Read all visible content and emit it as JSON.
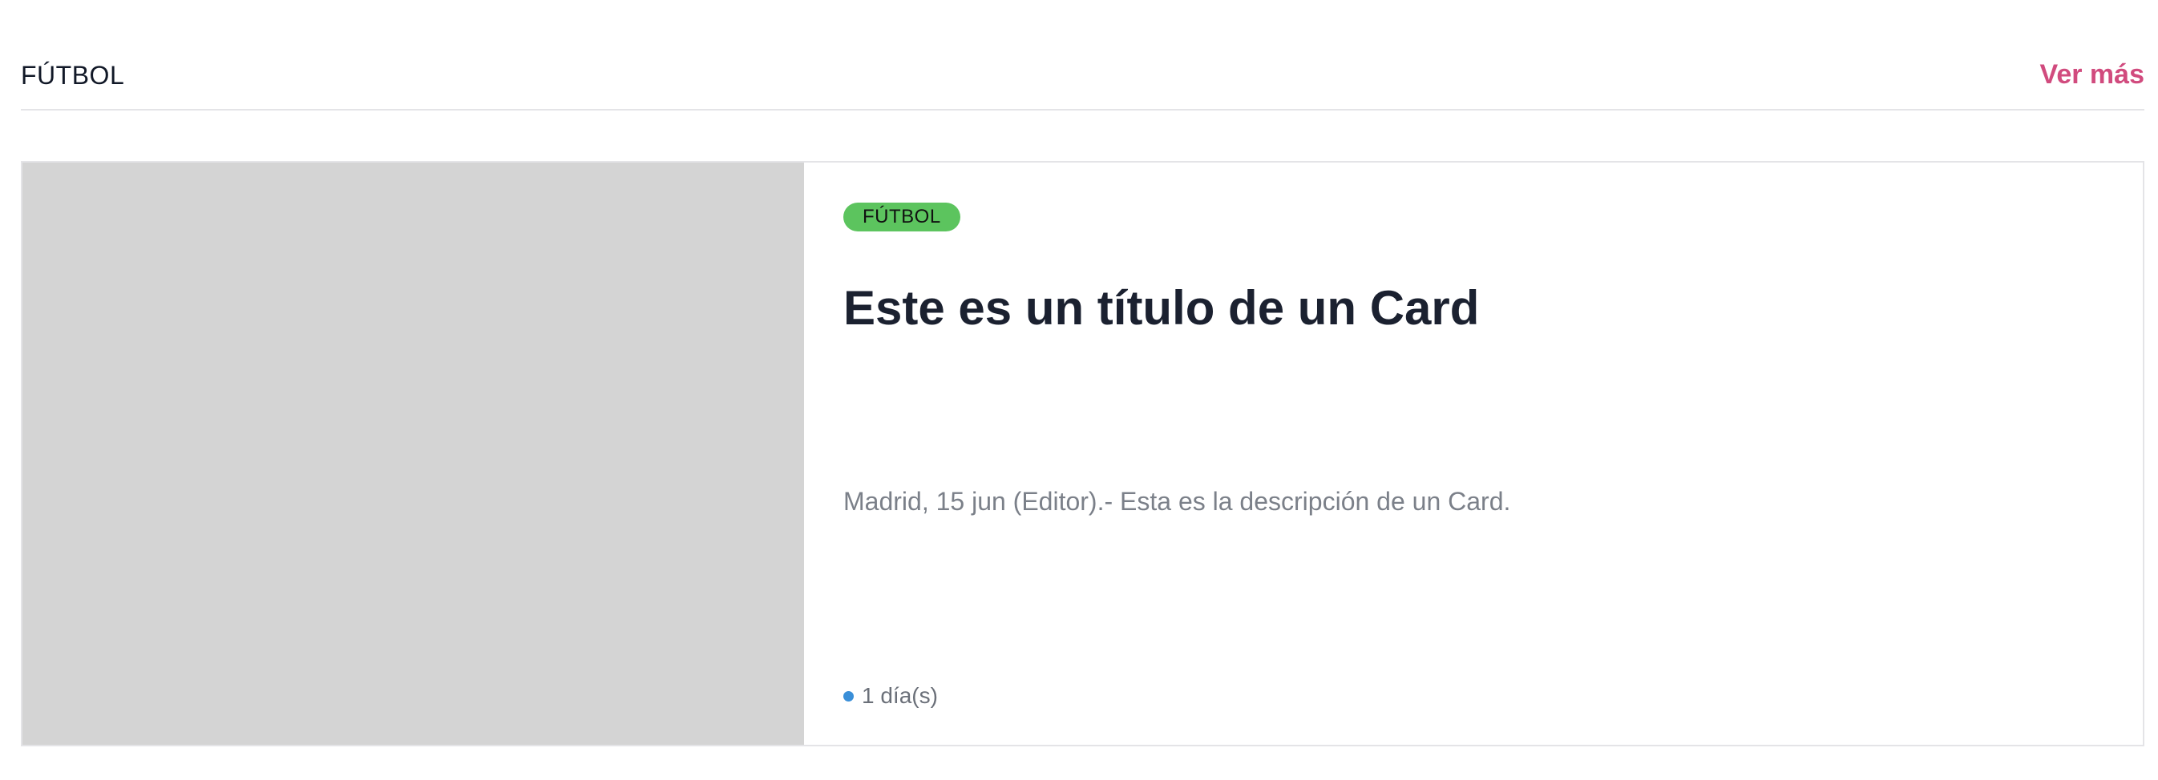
{
  "section": {
    "title": "FÚTBOL",
    "see_more_label": "Ver más"
  },
  "card": {
    "tag": "FÚTBOL",
    "title": "Este es un título de un Card",
    "description": "Madrid, 15 jun (Editor).- Esta es la descripción de un Card.",
    "time_ago": "1 día(s)"
  },
  "colors": {
    "accent": "#d14b7e",
    "tag_background": "#5cc45e",
    "image_placeholder": "#d4d4d4",
    "time_dot": "#3a8fd8"
  },
  "icons": {
    "time_indicator": "dot-icon"
  }
}
